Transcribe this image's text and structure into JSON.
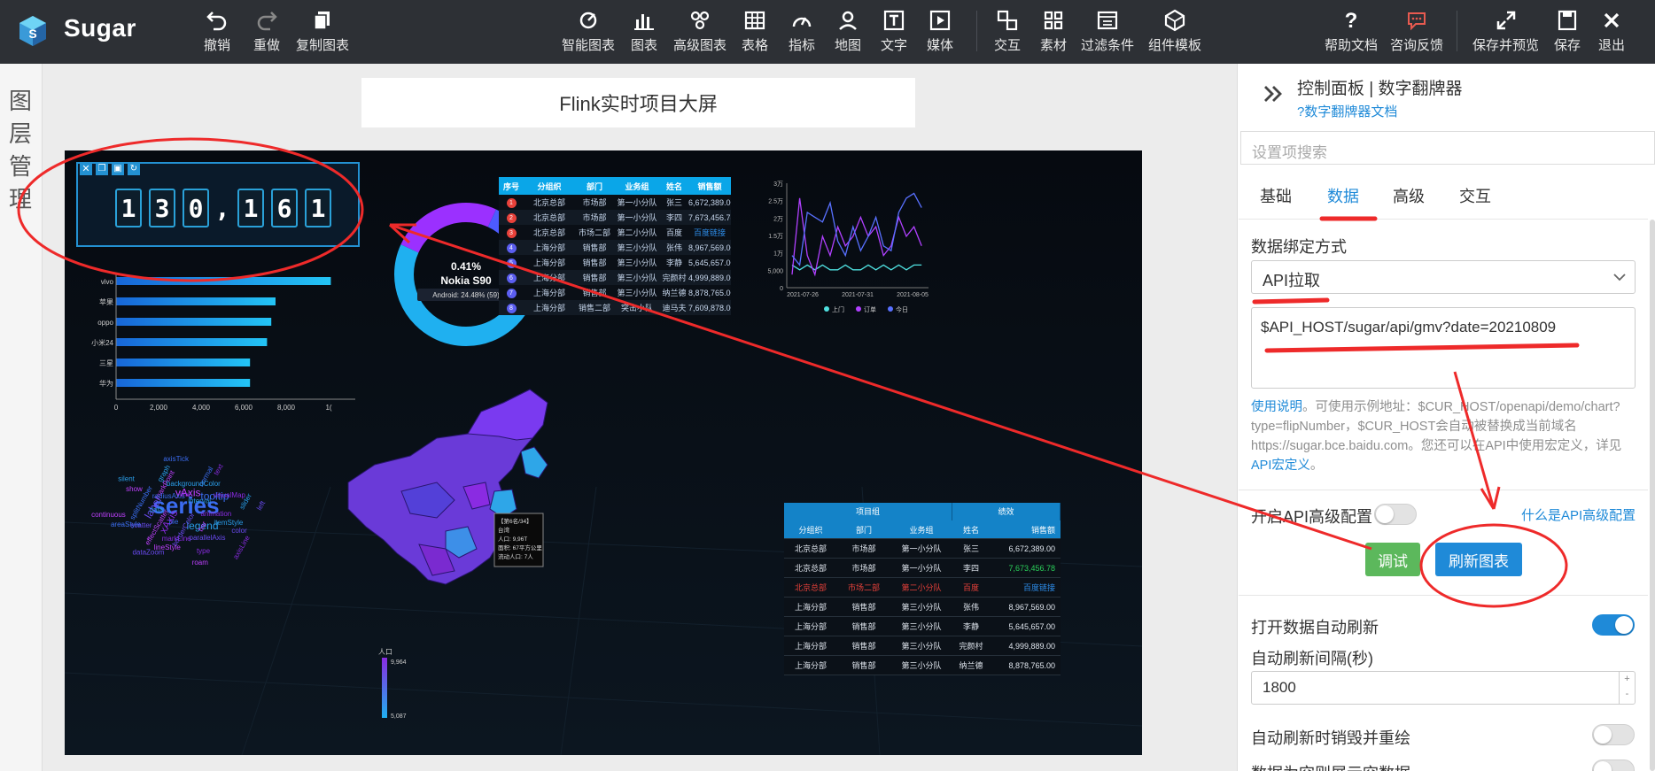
{
  "app": {
    "name": "Sugar"
  },
  "toolbar": {
    "undo": "撤销",
    "redo": "重做",
    "copy_chart": "复制图表",
    "smart_chart": "智能图表",
    "chart": "图表",
    "advanced_chart": "高级图表",
    "table": "表格",
    "indicator": "指标",
    "map": "地图",
    "text": "文字",
    "media": "媒体",
    "interaction": "交互",
    "material": "素材",
    "filter": "过滤条件",
    "component_template": "组件模板",
    "help_doc": "帮助文档",
    "feedback": "咨询反馈",
    "save_preview": "保存并预览",
    "save": "保存",
    "exit": "退出"
  },
  "layer_panel": {
    "label_chars": [
      "图",
      "层",
      "管",
      "理"
    ]
  },
  "canvas": {
    "title": "Flink实时项目大屏",
    "flip_number": {
      "digits": [
        "1",
        "3",
        "0",
        ",",
        "1",
        "6",
        "1"
      ]
    },
    "bar_chart": {
      "categories": [
        "vivo",
        "苹果",
        "oppo",
        "小米24",
        "三星",
        "华为"
      ],
      "values": [
        10100,
        7500,
        7300,
        7100,
        6300,
        6300
      ],
      "x_ticks": [
        "0",
        "2,000",
        "4,000",
        "6,000",
        "8,000",
        "1("
      ],
      "xlim": [
        0,
        10000
      ]
    },
    "donut": {
      "center_pct": "0.41%",
      "center_name": "Nokia S90",
      "tooltip": "Android: 24.48% (59)",
      "color_ring_outer": "#1fb0f0",
      "color_ring_inner": "#8a2be2"
    },
    "rank_table": {
      "headers": [
        "序号",
        "分组织",
        "部门",
        "业务组",
        "姓名",
        "销售额"
      ],
      "rows": [
        [
          "1",
          "北京总部",
          "市场部",
          "第一小分队",
          "张三",
          "6,672,389.00"
        ],
        [
          "2",
          "北京总部",
          "市场部",
          "第一小分队",
          "李四",
          "7,673,456.78"
        ],
        [
          "3",
          "北京总部",
          "市场二部",
          "第二小分队",
          "百度",
          "百度链接"
        ],
        [
          "4",
          "上海分部",
          "销售部",
          "第三小分队",
          "张伟",
          "8,967,569.00"
        ],
        [
          "5",
          "上海分部",
          "销售部",
          "第三小分队",
          "李静",
          "5,645,657.00"
        ],
        [
          "6",
          "上海分部",
          "销售部",
          "第三小分队",
          "完颜村",
          "4,999,889.00"
        ],
        [
          "7",
          "上海分部",
          "销售部",
          "第三小分队",
          "纳兰德",
          "8,878,765.00"
        ],
        [
          "8",
          "上海分部",
          "销售二部",
          "突击小队",
          "迪马夫",
          "7,609,878.00"
        ]
      ]
    },
    "line_chart": {
      "y_ticks": [
        "3万",
        "2.5万",
        "2万",
        "1.5万",
        "1万",
        "5,000",
        "0"
      ],
      "x_ticks": [
        "2021-07-26",
        "2021-07-31",
        "2021-08-05"
      ],
      "series": [
        {
          "name": "上门",
          "color": "#4fe0e0"
        },
        {
          "name": "订单",
          "color": "#b040ff"
        },
        {
          "name": "今日",
          "color": "#5870ff"
        }
      ]
    },
    "word_cloud": {
      "words": [
        "series",
        "xAxis",
        "yAxis",
        "legend",
        "label",
        "tooltip",
        "markLine",
        "markPoint",
        "itemStyle",
        "scatter",
        "normal",
        "type",
        "show",
        "slider",
        "dataZoom",
        "axisTick",
        "axisLine",
        "continuous",
        "interval",
        "borderColor",
        "radiusAxis",
        "animation",
        "effectScatter",
        "backgroundColor",
        "parallelAxis",
        "splitNumber",
        "visualMap",
        "lineStyle",
        "graph",
        "color",
        "areaStyle",
        "text",
        "roam",
        "silent",
        "left",
        "pie",
        "line",
        "bar",
        "data"
      ]
    },
    "map": {
      "tooltip_lines": [
        "【第6名/34】",
        "台湾",
        "人口: 9,96T",
        "面积: 67平方公里",
        "流动人口: 7人"
      ],
      "legend_title": "人口",
      "legend_max": "9,964",
      "legend_min": "5,087"
    },
    "group_table": {
      "group_headers": [
        "项目组",
        "绩效"
      ],
      "headers": [
        "分组织",
        "部门",
        "业务组",
        "姓名",
        "销售额"
      ],
      "rows": [
        [
          "北京总部",
          "市场部",
          "第一小分队",
          "张三",
          "6,672,389.00"
        ],
        [
          "北京总部",
          "市场部",
          "第一小分队",
          "李四",
          "7,673,456.78"
        ],
        [
          "北京总部",
          "市场二部",
          "第二小分队",
          "百度",
          "百度链接"
        ],
        [
          "上海分部",
          "销售部",
          "第三小分队",
          "张伟",
          "8,967,569.00"
        ],
        [
          "上海分部",
          "销售部",
          "第三小分队",
          "李静",
          "5,645,657.00"
        ],
        [
          "上海分部",
          "销售部",
          "第三小分队",
          "完颜村",
          "4,999,889.00"
        ],
        [
          "上海分部",
          "销售部",
          "第三小分队",
          "纳兰德",
          "8,878,765.00"
        ]
      ]
    }
  },
  "panel": {
    "title": "控制面板 | 数字翻牌器",
    "doc_link": "?数字翻牌器文档",
    "search_placeholder": "设置项搜索",
    "tabs": [
      "基础",
      "数据",
      "高级",
      "交互"
    ],
    "active_tab": "数据",
    "binding_label": "数据绑定方式",
    "binding_value": "API拉取",
    "api_url": "$API_HOST/sugar/api/gmv?date=20210809",
    "help_link": "使用说明",
    "help_text": "。可使用示例地址：$CUR_HOST/openapi/demo/chart?type=flipNumber，$CUR_HOST会自动被替换成当前域名https://sugar.bce.baidu.com。您还可以在API中使用宏定义，详见",
    "help_link2": "API宏定义",
    "help_end": "。",
    "adv_label": "开启API高级配置",
    "adv_link": "什么是API高级配置",
    "debug_btn": "调试",
    "refresh_btn": "刷新图表",
    "auto_refresh_label": "打开数据自动刷新",
    "auto_refresh_on": true,
    "interval_label": "自动刷新间隔(秒)",
    "interval_value": "1800",
    "destroy_label": "自动刷新时销毁并重绘",
    "empty_label": "数据为空则展示空数据"
  },
  "colors": {
    "accent": "#1f8ad8",
    "debug_green": "#5cb85c",
    "annotation_red": "#ee2a2a",
    "toolbar_bg": "#2d3035"
  }
}
